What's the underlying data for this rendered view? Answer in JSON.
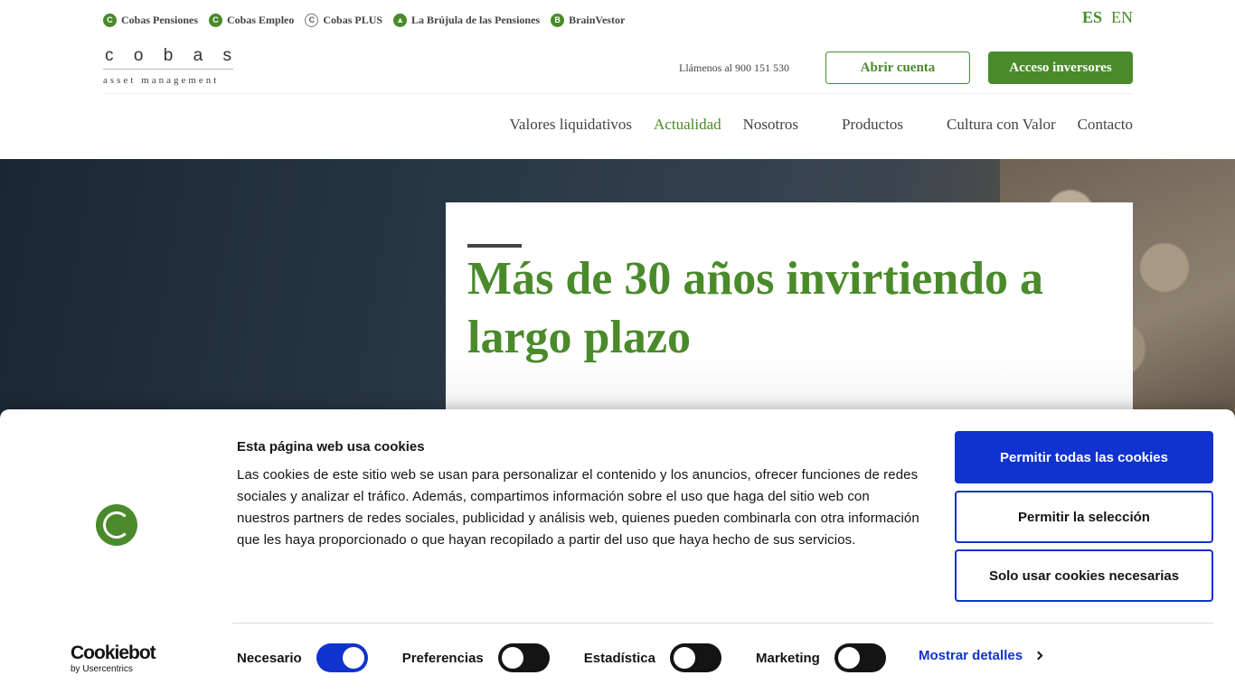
{
  "topbar": {
    "links": [
      {
        "label": "Cobas Pensiones",
        "icon": "cobas-c-icon"
      },
      {
        "label": "Cobas Empleo",
        "icon": "cobas-c-icon"
      },
      {
        "label": "Cobas PLUS",
        "icon": "cobas-plus-icon"
      },
      {
        "label": "La Brújula de las Pensiones",
        "icon": "compass-icon"
      },
      {
        "label": "BrainVestor",
        "icon": "brainvestor-b-icon"
      }
    ],
    "lang": {
      "es": "ES",
      "en": "EN"
    }
  },
  "logo": {
    "word": [
      "c",
      "o",
      "b",
      "a",
      "s"
    ],
    "sub": "asset management"
  },
  "header": {
    "phone": "Llámenos al 900 151 530",
    "open_account": "Abrir cuenta",
    "investor_access": "Acceso inversores"
  },
  "nav": {
    "items": [
      "Valores liquidativos",
      "Actualidad",
      "Nosotros",
      "Productos",
      "Cultura con Valor",
      "Contacto"
    ],
    "active": "Actualidad"
  },
  "hero": {
    "title": "Más de 30 años invirtiendo a largo plazo"
  },
  "cookies": {
    "title": "Esta página web usa cookies",
    "text": "Las cookies de este sitio web se usan para personalizar el contenido y los anuncios, ofrecer funciones de redes sociales y analizar el tráfico. Además, compartimos información sobre el uso que haga del sitio web con nuestros partners de redes sociales, publicidad y análisis web, quienes pueden combinarla con otra información que les haya proporcionado o que hayan recopilado a partir del uso que haya hecho de sus servicios.",
    "allow_all": "Permitir todas las cookies",
    "allow_selection": "Permitir la selección",
    "necessary_only": "Solo usar cookies necesarias",
    "toggles": [
      {
        "label": "Necesario",
        "on": true
      },
      {
        "label": "Preferencias",
        "on": false
      },
      {
        "label": "Estadística",
        "on": false
      },
      {
        "label": "Marketing",
        "on": false
      }
    ],
    "show_details": "Mostrar detalles",
    "brand": "Cookiebot",
    "brand_sub": "by Usercentrics"
  },
  "colors": {
    "brand_green": "#4a8a2b",
    "cookie_blue": "#1032cf"
  }
}
